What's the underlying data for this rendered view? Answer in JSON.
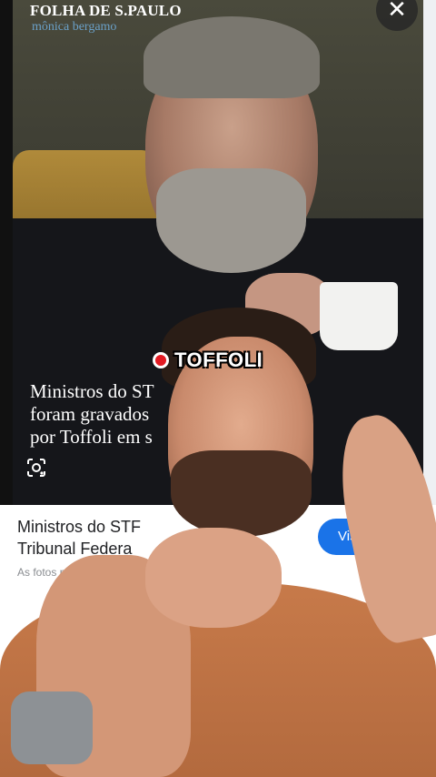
{
  "preview": {
    "brand": "FOLHA DE S.PAULO",
    "brand_sub": "mônica bergamo",
    "headline": [
      "Ministros do ST",
      "foram gravados",
      "por Toffoli em s"
    ]
  },
  "card": {
    "title_line1": "Ministros do STF",
    "title_line2": "Tribunal Federa",
    "subtitle": "As fotos podem te",
    "visit_label": "Visit"
  },
  "caption": {
    "text": "TOFFOLI"
  },
  "icons": [
    "close-icon",
    "lens-icon",
    "record-dot-icon"
  ],
  "colors": {
    "accent_blue": "#1a73e8",
    "record_red": "#e31b23"
  }
}
